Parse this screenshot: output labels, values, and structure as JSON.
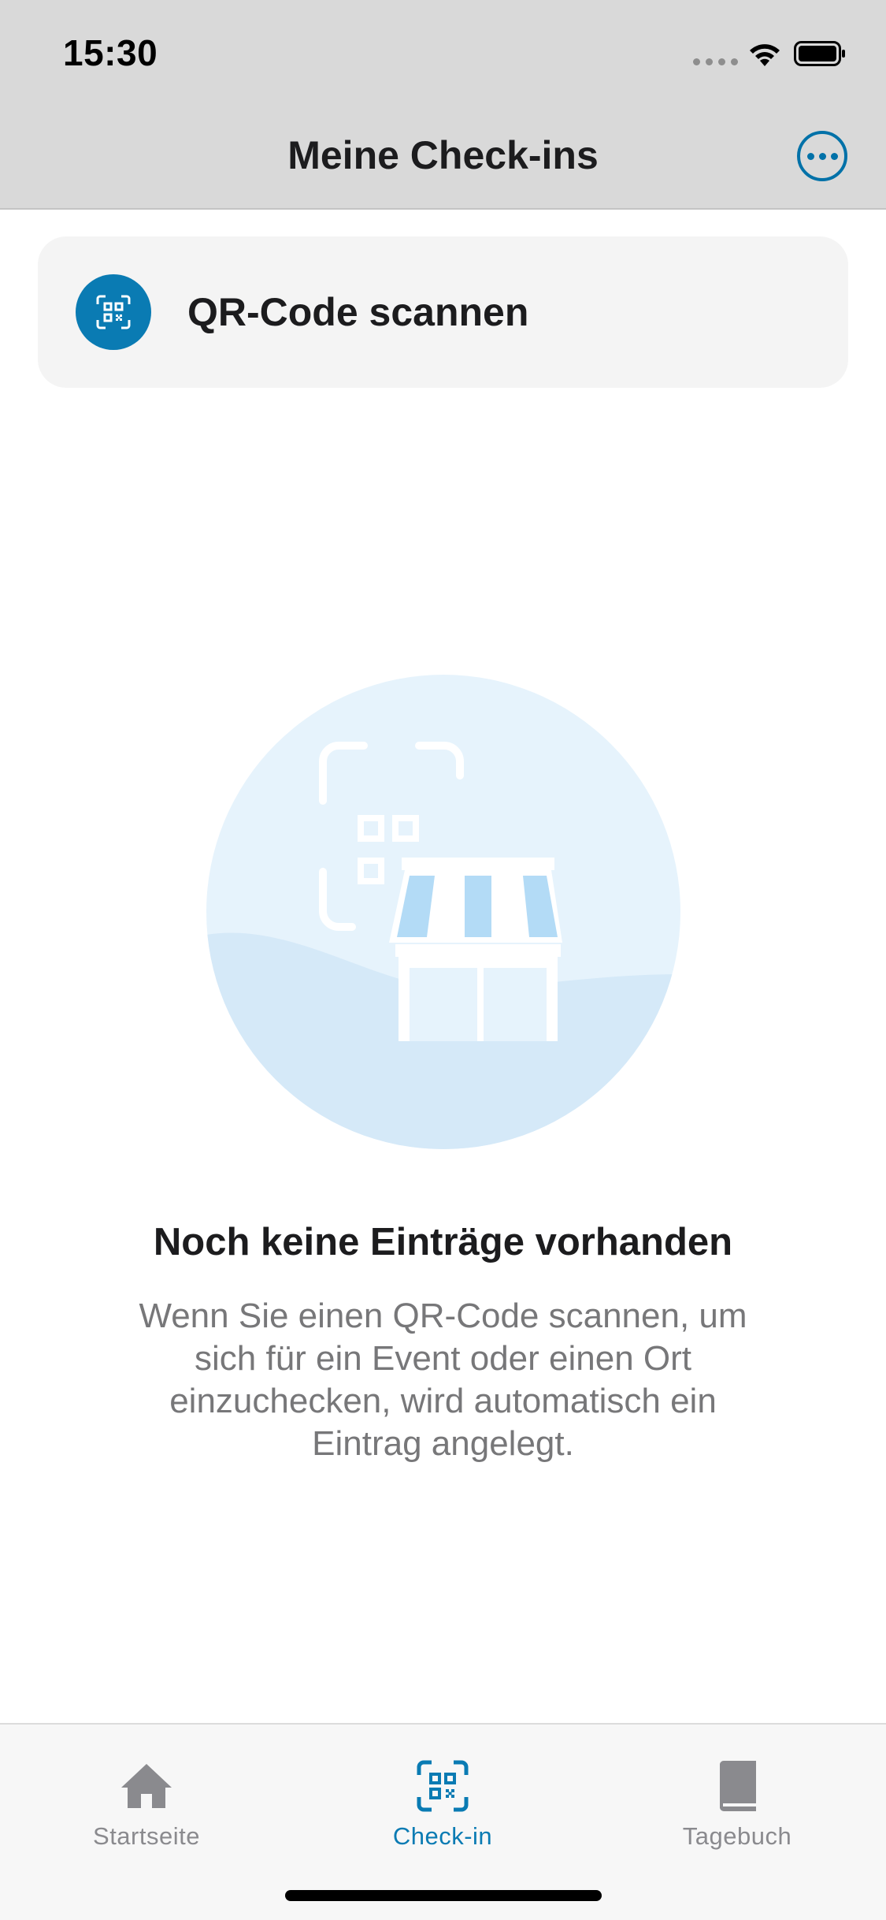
{
  "status_bar": {
    "time": "15:30",
    "signal_icon": "cellular-signal-icon",
    "wifi_icon": "wifi-icon",
    "battery_icon": "battery-icon"
  },
  "nav": {
    "title": "Meine Check-ins",
    "more_icon": "ellipsis-circle-icon"
  },
  "scan_card": {
    "label": "QR-Code scannen",
    "icon": "qr-code-scan-icon"
  },
  "empty_state": {
    "illustration": "qr-code-store-illustration",
    "title": "Noch keine Einträge vorhanden",
    "text": "Wenn Sie einen QR-Code scannen, um sich für ein Event oder einen Ort einzuchecken, wird automatisch ein Eintrag angelegt."
  },
  "tabbar": {
    "items": [
      {
        "label": "Startseite",
        "icon": "house-icon",
        "active": false
      },
      {
        "label": "Check-in",
        "icon": "qr-code-scan-icon",
        "active": true
      },
      {
        "label": "Tagebuch",
        "icon": "book-icon",
        "active": false
      }
    ]
  },
  "colors": {
    "accent": "#0a7bb3",
    "header_background": "#d9d9d9",
    "card_background": "#f4f4f4",
    "illustration_light": "#e6f3fc",
    "illustration_mid": "#d5e9f8",
    "illustration_accent": "#b3dbf6",
    "inactive_tab": "#8a8a8e"
  }
}
